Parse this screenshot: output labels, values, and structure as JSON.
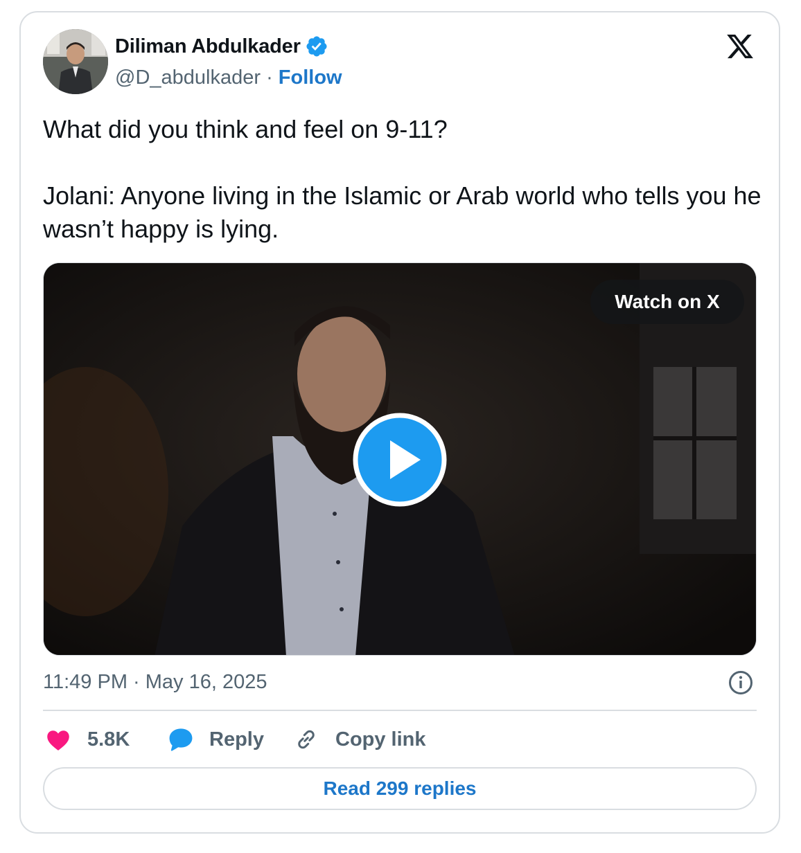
{
  "author": {
    "name": "Diliman Abdulkader",
    "handle": "@D_abdulkader",
    "separator": "·",
    "follow_label": "Follow",
    "verified_icon": "verified-badge-icon",
    "verified_color": "#1d9bf0"
  },
  "tweet": {
    "paragraphs": [
      "What did you think and feel on 9-11?",
      "Jolani: Anyone living in the Islamic or Arab world who tells you he wasn’t happy is lying."
    ],
    "timestamp": "11:49 PM · May 16, 2025"
  },
  "media": {
    "type": "video",
    "watch_label": "Watch on X",
    "play_icon": "play-icon",
    "play_color": "#1d9bf0"
  },
  "actions": {
    "like_count": "5.8K",
    "like_color": "#f91880",
    "reply_label": "Reply",
    "reply_color": "#1d9bf0",
    "copy_label": "Copy link"
  },
  "read_replies_label": "Read 299 replies",
  "colors": {
    "link": "#1d77c9",
    "muted": "#536471",
    "border": "#d9dde1"
  }
}
